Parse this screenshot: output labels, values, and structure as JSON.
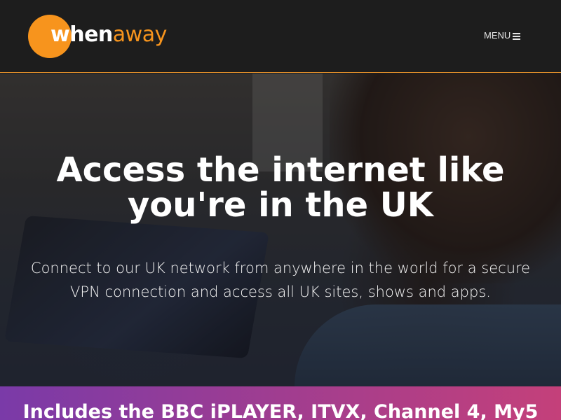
{
  "brand": {
    "name_part1": "when",
    "name_part2": "away",
    "accent_color": "#f7941d"
  },
  "header": {
    "menu_label": "MENU",
    "menu_icon": "hamburger-icon"
  },
  "hero": {
    "title": "Access the internet like you're in the UK",
    "subtitle": "Connect to our UK network from anywhere in the world for a secure VPN connection and access all UK sites, shows and apps."
  },
  "banner": {
    "text": "Includes the BBC iPLAYER, ITVX, Channel 4, My5",
    "color_start": "#7a3aa8",
    "color_end": "#c4407a"
  }
}
